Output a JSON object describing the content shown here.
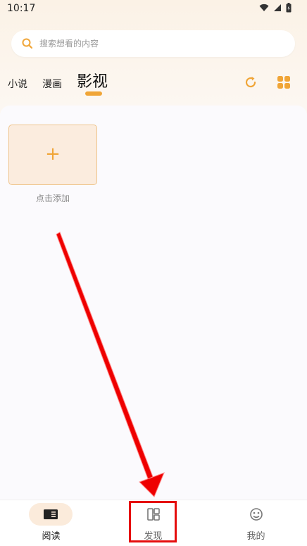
{
  "status_bar": {
    "time": "10:17"
  },
  "search": {
    "placeholder": "搜索想看的内容"
  },
  "tabs": [
    {
      "label": "小说",
      "active": false
    },
    {
      "label": "漫画",
      "active": false
    },
    {
      "label": "影视",
      "active": true
    }
  ],
  "header_icons": [
    "refresh-icon",
    "grid-icon"
  ],
  "add_card": {
    "symbol": "+",
    "label": "点击添加"
  },
  "bottom_nav": [
    {
      "label": "阅读",
      "icon": "book-icon",
      "active": true
    },
    {
      "label": "发现",
      "icon": "discover-icon",
      "active": false
    },
    {
      "label": "我的",
      "icon": "profile-icon",
      "active": false
    }
  ],
  "colors": {
    "accent": "#f0a537",
    "annotation_red": "#e50d0d",
    "card_bg": "#fbecde"
  }
}
